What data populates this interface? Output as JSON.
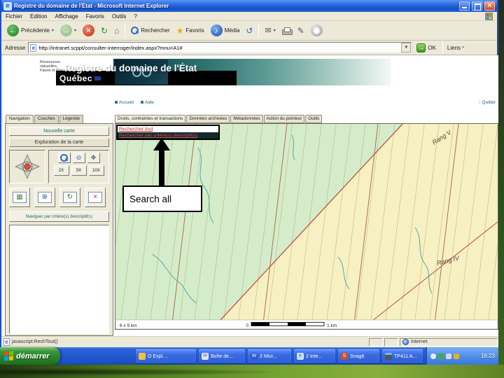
{
  "colors": {
    "titlebar_blue": "#1e5cd0",
    "banner_teal": "#2f7472",
    "map_green": "#d4ecca",
    "map_yellow": "#f6f0c2",
    "link_red": "#b22222",
    "taskbar_blue": "#2458cf",
    "start_green": "#2b852b"
  },
  "titlebar": {
    "title": "Registre du domaine de l'État - Microsoft Internet Explorer"
  },
  "menubar": {
    "items": [
      "Fichier",
      "Edition",
      "Affichage",
      "Favoris",
      "Outils",
      "?"
    ]
  },
  "toolbar": {
    "back": "Précédente",
    "search": "Rechercher",
    "favorites": "Favoris",
    "media": "Média"
  },
  "addressbar": {
    "label": "Adresse",
    "url": "http://intranet.scppt/consulter-interroger/index.aspx?mnu=A1#",
    "go": "OK",
    "links": "Liens"
  },
  "banner": {
    "logo1": "Ressources",
    "logo2": "naturelles,",
    "logo3": "Faune et Parcs",
    "quebec": "Québec",
    "title": "Registre du domaine de l'État"
  },
  "pagenav": {
    "home": "Accueil",
    "help": "Aide",
    "quit": ":: Quitter"
  },
  "sidebar": {
    "tabs": [
      "Navigation",
      "Couches",
      "Légende"
    ],
    "new_map": "Nouvelle carte",
    "explore": "Exploration de la carte",
    "zooms": [
      "2X",
      "5X",
      "10X"
    ],
    "navigate_btn": "Naviguer par critère(s) descriptif(s)"
  },
  "maintabs": {
    "items": [
      "Droits, contraintes et transactions",
      "Données archivées",
      "Métadonnées",
      "Action du pointeur",
      "Outils"
    ]
  },
  "dropdown": {
    "item1": "Rechercher tout",
    "item2": "Rechercher par critère(s) descriptif(s)"
  },
  "map": {
    "rang_v": "Rang V",
    "rang_iv": "Rang IV",
    "size": "6 x 9 km",
    "scale_start": "0",
    "scale_end": "1 km"
  },
  "annotation": {
    "label": "Search all"
  },
  "statusbar": {
    "left": "javascript:RechTout()",
    "zone": "Internet"
  },
  "taskbar": {
    "start": "démarrer",
    "items": [
      "O Expl. ..",
      "Boîte de...",
      "2 Micr...",
      "2 Inte...",
      "SnagIt",
      "TP411:A..."
    ],
    "time": "16:23"
  }
}
